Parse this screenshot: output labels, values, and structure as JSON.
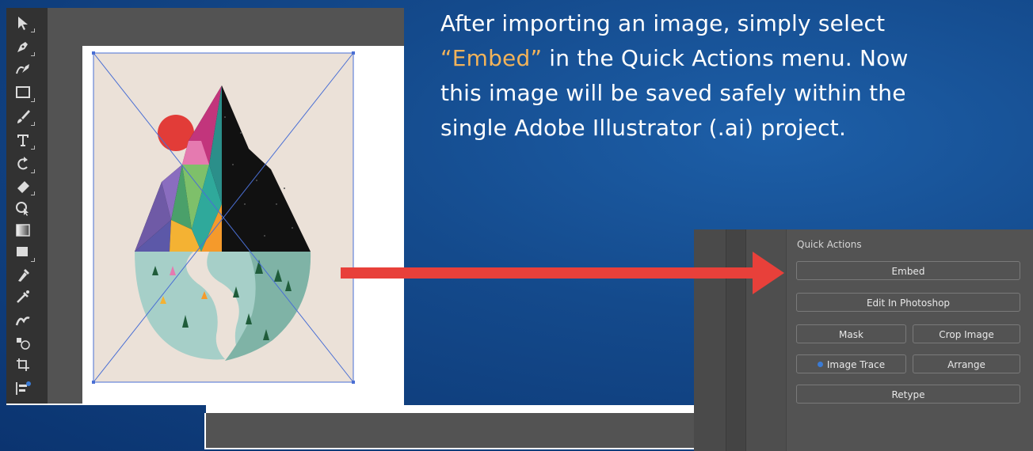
{
  "caption": {
    "line1": "After importing an image, simply select",
    "highlight": "“Embed”",
    "line2_rest": " in the Quick Actions menu. Now",
    "line3": "this image will be saved safely within the",
    "line4": "single Adobe Illustrator (.ai) project."
  },
  "colors": {
    "highlight": "#f2b35a",
    "arrow": "#e8403a",
    "background": "#144a8c"
  },
  "toolbar": {
    "tools": [
      "selection-tool-icon",
      "pen-tool-icon",
      "curvature-tool-icon",
      "rectangle-tool-icon",
      "paintbrush-tool-icon",
      "type-tool-icon",
      "rotate-tool-icon",
      "eraser-tool-icon",
      "shape-builder-tool-icon",
      "gradient-tool-icon",
      "blend-tool-icon",
      "eyedropper-tool-icon",
      "puppet-warp-tool-icon",
      "symbol-sprayer-tool-icon",
      "artboard-tool-icon",
      "graph-tool-icon"
    ]
  },
  "quick_actions": {
    "title": "Quick Actions",
    "embed": "Embed",
    "edit_in_photoshop": "Edit In Photoshop",
    "mask": "Mask",
    "crop_image": "Crop Image",
    "image_trace": "Image Trace",
    "arrange": "Arrange",
    "retype": "Retype"
  }
}
